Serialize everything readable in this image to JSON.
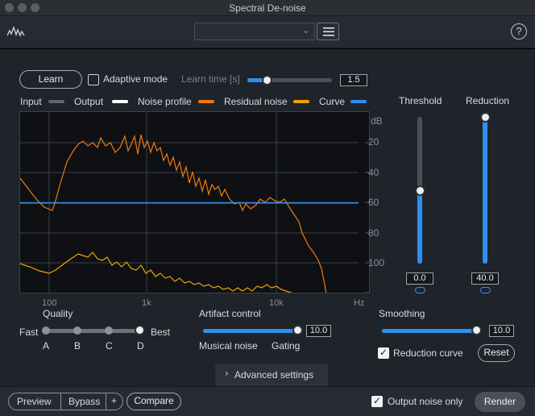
{
  "window": {
    "title": "Spectral De-noise"
  },
  "header": {
    "preset_value": "",
    "logo_icon": "waveform-logo-icon",
    "menu_icon": "hamburger-icon",
    "help_label": "?"
  },
  "learn": {
    "button_label": "Learn",
    "adaptive_label": "Adaptive mode",
    "adaptive_checked": false,
    "learn_time_label": "Learn time [s]",
    "learn_time_value": "1.5",
    "learn_time_fraction": 0.23
  },
  "legend": [
    {
      "label": "Input",
      "color": "#62676e"
    },
    {
      "label": "Output",
      "color": "#ffffff"
    },
    {
      "label": "Noise profile",
      "color": "#f07a10"
    },
    {
      "label": "Residual noise",
      "color": "#f0a400"
    },
    {
      "label": "Curve",
      "color": "#2f8ff0"
    }
  ],
  "graph": {
    "unit_label": "dB",
    "y_ticks": [
      "20",
      "40",
      "60",
      "80",
      "100"
    ],
    "x_ticks": [
      "100",
      "1k",
      "10k"
    ],
    "x_unit": "Hz",
    "curve_db": 60
  },
  "threshold": {
    "label": "Threshold",
    "value": "0.0",
    "fraction": 0.5,
    "link_icon": "link-icon"
  },
  "reduction": {
    "label": "Reduction",
    "value": "40.0",
    "fraction": 1.0,
    "link_icon": "link-icon"
  },
  "quality": {
    "label": "Quality",
    "left": "Fast",
    "right": "Best",
    "options": [
      "A",
      "B",
      "C",
      "D"
    ],
    "selected": "D"
  },
  "artifact": {
    "label": "Artifact control",
    "value": "10.0",
    "fraction": 1.0,
    "left": "Musical noise",
    "right": "Gating"
  },
  "smoothing": {
    "label": "Smoothing",
    "value": "10.0",
    "fraction": 1.0
  },
  "reduction_curve": {
    "label": "Reduction curve",
    "checked": true
  },
  "reset": {
    "label": "Reset"
  },
  "advanced": {
    "label": "Advanced settings"
  },
  "footer": {
    "preview": "Preview",
    "bypass": "Bypass",
    "plus": "+",
    "compare": "Compare",
    "output_noise_label": "Output noise only",
    "output_noise_checked": true,
    "render": "Render"
  }
}
